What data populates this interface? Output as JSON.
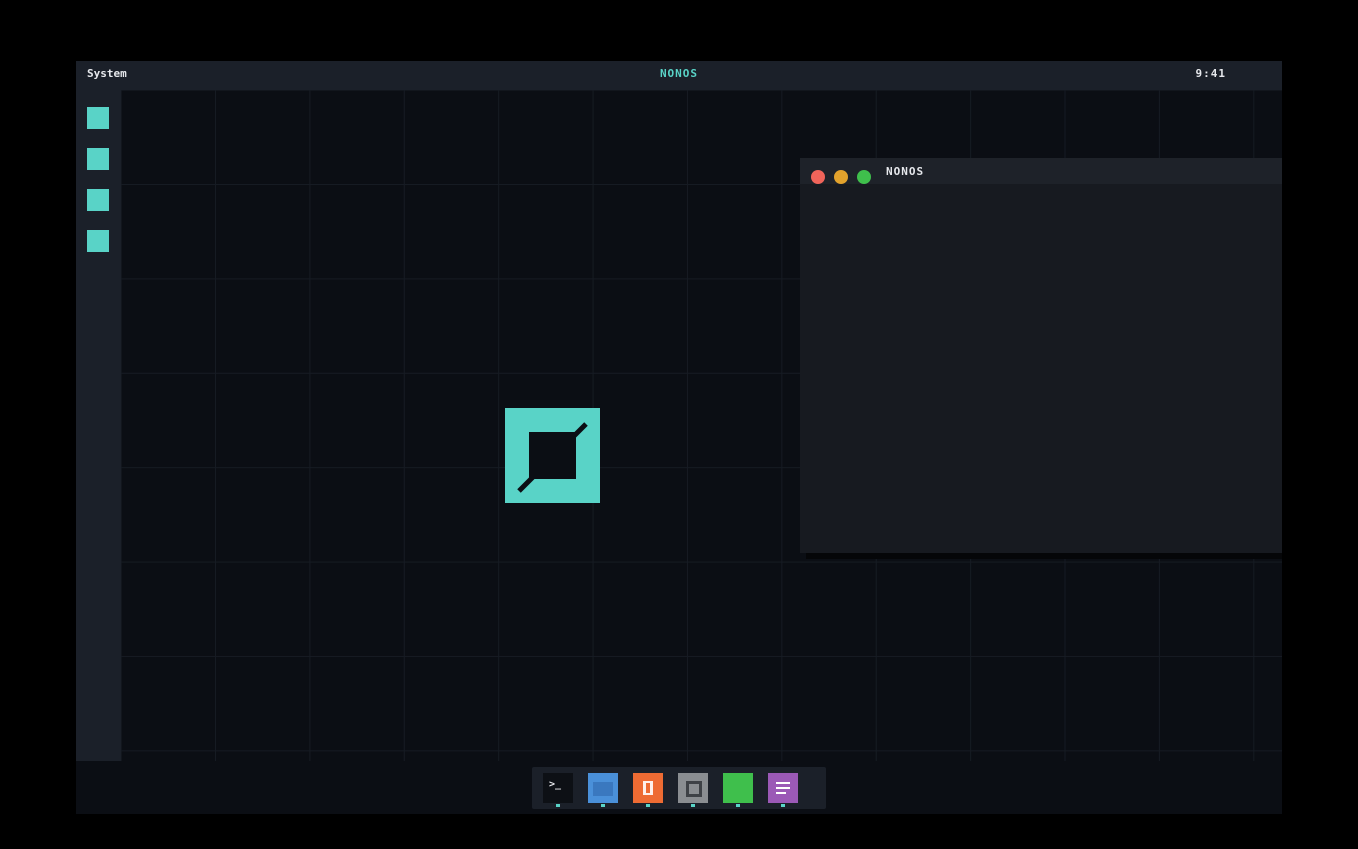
{
  "topbar": {
    "menu_label": "System",
    "title": "NONOS",
    "clock": "9:41"
  },
  "sidebar": {
    "items": [
      {
        "icon": "app-square-icon"
      },
      {
        "icon": "app-square-icon"
      },
      {
        "icon": "app-square-icon"
      },
      {
        "icon": "app-square-icon"
      }
    ]
  },
  "window": {
    "title": "NONOS",
    "controls": {
      "close_color": "#f0645a",
      "minimize_color": "#e2a22c",
      "maximize_color": "#3fbf4c"
    }
  },
  "dock": {
    "items": [
      {
        "icon": "terminal-icon",
        "glyph": ">_",
        "color": "#0d1015"
      },
      {
        "icon": "folder-icon",
        "color": "#4a90d9"
      },
      {
        "icon": "editor-icon",
        "color": "#ee6b33"
      },
      {
        "icon": "settings-icon",
        "color": "#8a8d91"
      },
      {
        "icon": "green-app-icon",
        "color": "#3fbf4c"
      },
      {
        "icon": "menu-icon",
        "color": "#9b59b6"
      }
    ]
  },
  "colors": {
    "accent": "#59d3c7",
    "background": "#0b0e14",
    "panel": "#1b2029"
  }
}
